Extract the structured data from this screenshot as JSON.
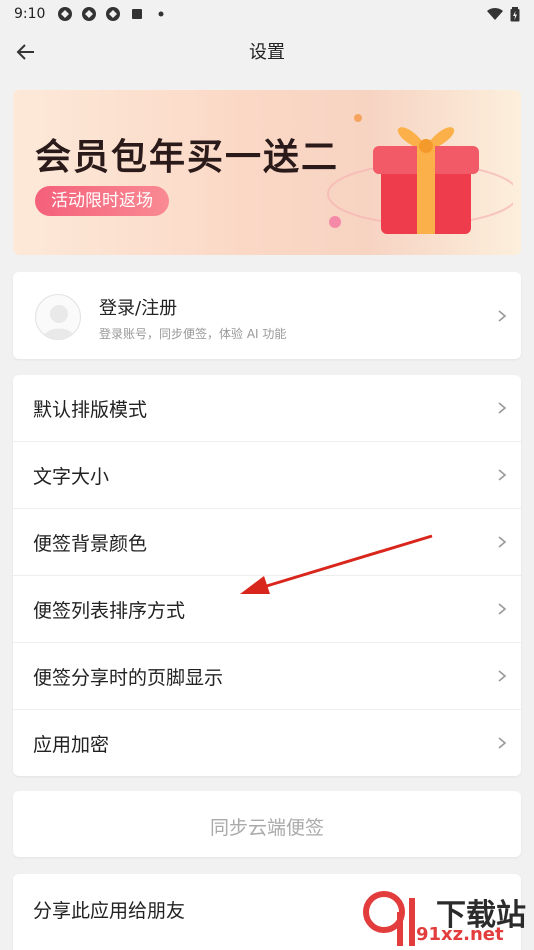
{
  "status_bar": {
    "time": "9:10"
  },
  "app_bar": {
    "title": "设置"
  },
  "banner": {
    "headline": "会员包年买一送二",
    "pill": "活动限时返场"
  },
  "login": {
    "title": "登录/注册",
    "subtitle": "登录账号，同步便签，体验 AI 功能"
  },
  "settings": {
    "items": [
      {
        "label": "默认排版模式"
      },
      {
        "label": "文字大小"
      },
      {
        "label": "便签背景颜色"
      },
      {
        "label": "便签列表排序方式"
      },
      {
        "label": "便签分享时的页脚显示"
      },
      {
        "label": "应用加密"
      }
    ]
  },
  "sync": {
    "label": "同步云端便签"
  },
  "share": {
    "label": "分享此应用给朋友"
  },
  "watermark": {
    "name": "下载站",
    "site": "91xz.net"
  },
  "colors": {
    "accent_pink": "#f4607a",
    "annotation_red": "#d9261c"
  }
}
